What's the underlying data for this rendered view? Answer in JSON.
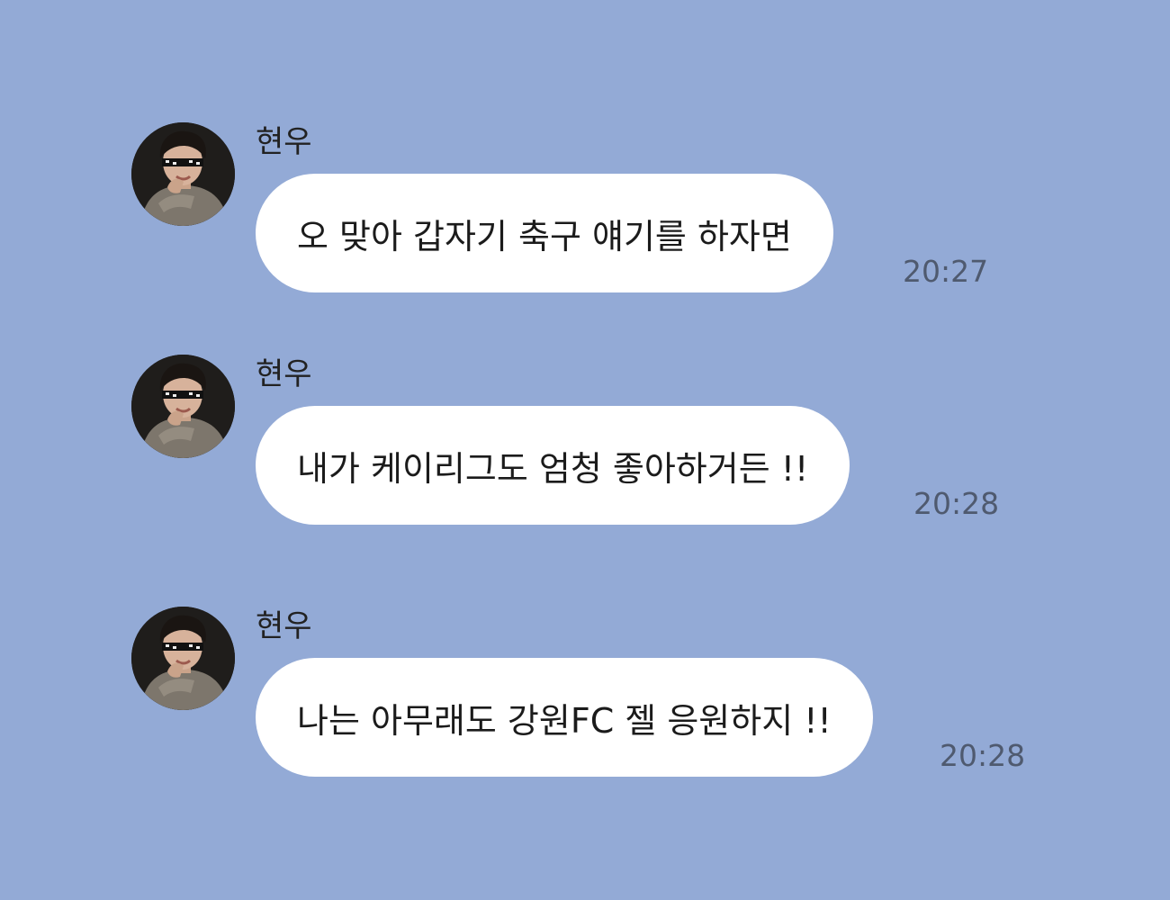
{
  "chat": {
    "messages": [
      {
        "sender": "현우",
        "text": "오 맞아 갑자기 축구 얘기를 하자면",
        "time": "20:27",
        "avatar": "profile-photo"
      },
      {
        "sender": "현우",
        "text": "내가 케이리그도 엄청 좋아하거든 !!",
        "time": "20:28",
        "avatar": "profile-photo"
      },
      {
        "sender": "현우",
        "text": "나는 아무래도 강원FC 젤 응원하지 !!",
        "time": "20:28",
        "avatar": "profile-photo"
      }
    ]
  },
  "colors": {
    "background": "#93aad6",
    "bubble": "#ffffff",
    "time_text": "#4f5a6f"
  }
}
